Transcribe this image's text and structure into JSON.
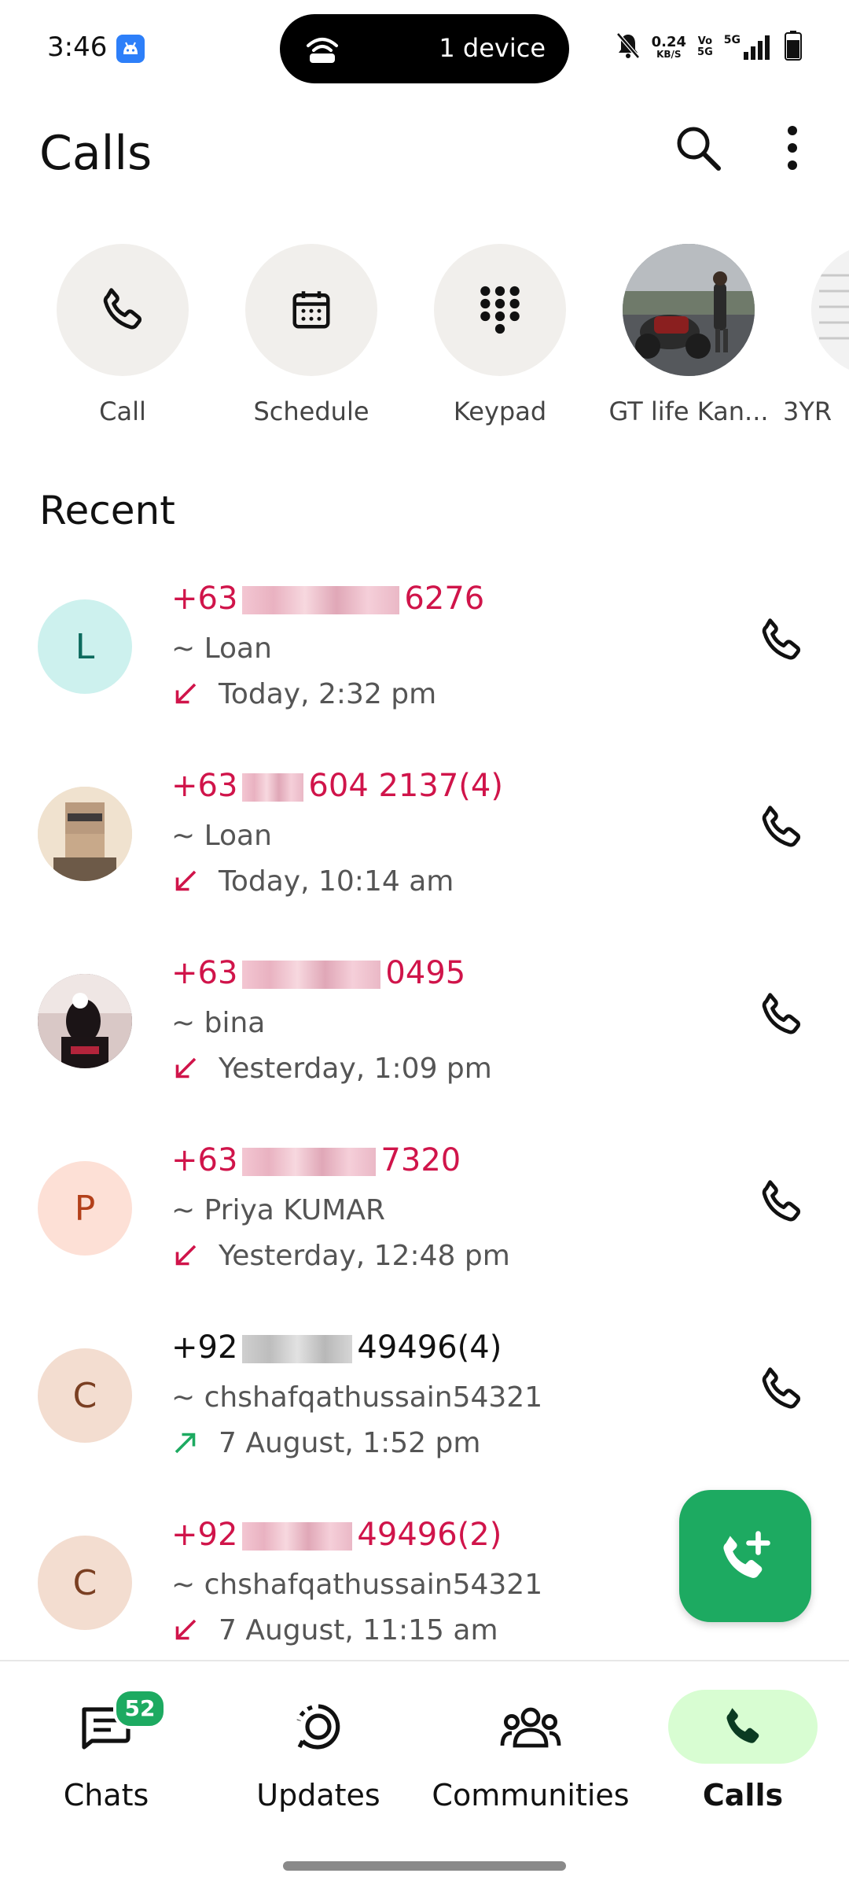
{
  "status_bar": {
    "time": "3:46",
    "hotspot_text": "1 device",
    "net_speed_value": "0.24",
    "net_speed_unit": "KB/S",
    "volte_top": "Vo",
    "volte_bottom": "5G",
    "network_type": "5G",
    "icons": [
      "app-notification-icon",
      "hotspot-icon",
      "mute-icon",
      "signal-icon",
      "battery-icon"
    ]
  },
  "header": {
    "title": "Calls",
    "icons": [
      "search-icon",
      "more-vertical-icon"
    ]
  },
  "quick_actions": [
    {
      "label": "Call",
      "icon": "phone-icon"
    },
    {
      "label": "Schedule",
      "icon": "calendar-icon"
    },
    {
      "label": "Keypad",
      "icon": "dialpad-icon"
    },
    {
      "label": "GT life Kan...",
      "icon": "contact-photo"
    },
    {
      "label": "3YR",
      "icon": "contact-photo"
    }
  ],
  "recent": {
    "title": "Recent",
    "calls": [
      {
        "number_prefix": "+63",
        "number_suffix": "6276",
        "count": "",
        "name": "~ Loan",
        "time": "Today, 2:32 pm",
        "direction": "incoming-missed",
        "status_color": "#d0144a",
        "avatar_letter": "L",
        "avatar_bg": "#cdf1ee",
        "avatar_fg": "#0d6b5e"
      },
      {
        "number_prefix": "+63",
        "number_suffix": "604 2137",
        "count": "(4)",
        "name": "~ Loan",
        "time": "Today, 10:14 am",
        "direction": "incoming-missed",
        "status_color": "#d0144a",
        "avatar_letter": "",
        "avatar_bg": "#e8d8c4",
        "avatar_fg": "#5a3b22"
      },
      {
        "number_prefix": "+63",
        "number_suffix": "0495",
        "count": "",
        "name": "~ bina",
        "time": "Yesterday, 1:09 pm",
        "direction": "incoming-missed",
        "status_color": "#d0144a",
        "avatar_letter": "",
        "avatar_bg": "#3a2a30",
        "avatar_fg": "#ffffff"
      },
      {
        "number_prefix": "+63",
        "number_suffix": "7320",
        "count": "",
        "name": "~ Priya KUMAR",
        "time": "Yesterday, 12:48 pm",
        "direction": "incoming-missed",
        "status_color": "#d0144a",
        "avatar_letter": "P",
        "avatar_bg": "#fde0d6",
        "avatar_fg": "#b3401a"
      },
      {
        "number_prefix": "+92",
        "number_suffix": "49496",
        "count": "(4)",
        "name": "~ chshafqathussain54321",
        "time": "7 August, 1:52 pm",
        "direction": "outgoing",
        "status_color": "#1daa61",
        "avatar_letter": "C",
        "avatar_bg": "#f3ddd0",
        "avatar_fg": "#7a3f22"
      },
      {
        "number_prefix": "+92",
        "number_suffix": "49496",
        "count": "(2)",
        "name": "~ chshafqathussain54321",
        "time": "7 August, 11:15 am",
        "direction": "incoming-missed",
        "status_color": "#d0144a",
        "avatar_letter": "C",
        "avatar_bg": "#f3ddd0",
        "avatar_fg": "#7a3f22"
      }
    ]
  },
  "fab": {
    "icon": "add-call-icon"
  },
  "bottom_nav": [
    {
      "label": "Chats",
      "icon": "chats-icon",
      "badge": "52",
      "active": false
    },
    {
      "label": "Updates",
      "icon": "updates-icon",
      "badge": "",
      "active": false
    },
    {
      "label": "Communities",
      "icon": "communities-icon",
      "badge": "",
      "active": false
    },
    {
      "label": "Calls",
      "icon": "calls-icon",
      "badge": "",
      "active": true
    }
  ],
  "colors": {
    "missed": "#d0144a",
    "outgoing": "#1daa61",
    "accent": "#1daa61",
    "active_tab_bg": "#d8fdd2"
  }
}
